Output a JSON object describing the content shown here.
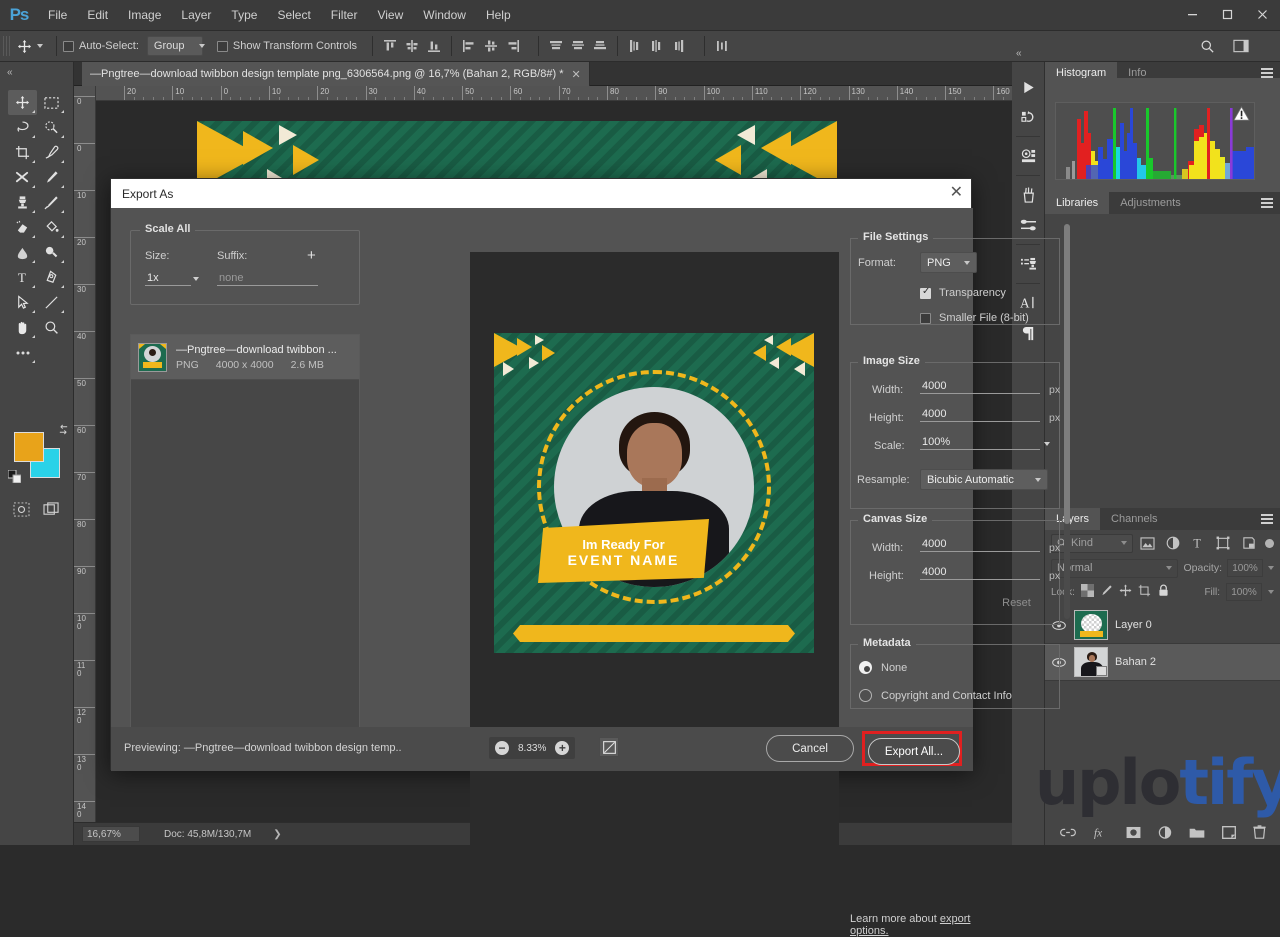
{
  "app": {
    "logo": "Ps",
    "menus": [
      "File",
      "Edit",
      "Image",
      "Layer",
      "Type",
      "Select",
      "Filter",
      "View",
      "Window",
      "Help"
    ],
    "window_controls": {
      "minimize": "–",
      "maximize": "❐",
      "close": "✕"
    }
  },
  "options_bar": {
    "auto_select_label": "Auto-Select:",
    "auto_select_checked": false,
    "group_value": "Group",
    "show_transform_label": "Show Transform Controls",
    "show_transform_checked": false
  },
  "document_tab": {
    "title": "—Pngtree—download twibbon design template png_6306564.png @ 16,7% (Bahan 2, RGB/8#) *",
    "close": "✕"
  },
  "rulers": {
    "horizontal_labels": [
      "20",
      "10",
      "0",
      "10",
      "20",
      "30",
      "40",
      "50",
      "60",
      "70",
      "80",
      "90",
      "100",
      "110",
      "120",
      "130",
      "140",
      "150",
      "160"
    ],
    "vertical_labels": [
      "0",
      "0",
      "10",
      "20",
      "30",
      "40",
      "50",
      "60",
      "70",
      "80",
      "90",
      "100",
      "110",
      "120",
      "130",
      "140"
    ]
  },
  "status_bar": {
    "zoom": "16,67%",
    "doc": "Doc: 45,8M/130,7M",
    "arrow": "❯"
  },
  "panels": {
    "histogram": {
      "tabs": [
        "Histogram",
        "Info"
      ],
      "active": "Histogram",
      "warning_icon": "warning-triangle"
    },
    "libraries": {
      "tabs": [
        "Libraries",
        "Adjustments"
      ],
      "active": "Libraries"
    },
    "layers": {
      "tabs": [
        "Layers",
        "Channels"
      ],
      "active": "Layers",
      "kind_filter": "Kind",
      "blend_mode": "Normal",
      "opacity_label": "Opacity:",
      "opacity_value": "100%",
      "lock_label": "Lock:",
      "fill_label": "Fill:",
      "fill_value": "100%",
      "rows": [
        {
          "name": "Layer 0",
          "visible": true,
          "selected": false
        },
        {
          "name": "Bahan 2",
          "visible": true,
          "selected": true
        }
      ]
    }
  },
  "dialog": {
    "title": "Export As",
    "close": "✕",
    "scale_all": {
      "group_label": "Scale All",
      "size_label": "Size:",
      "size_value": "1x",
      "suffix_label": "Suffix:",
      "suffix_placeholder": "none",
      "add_label": "+"
    },
    "asset": {
      "name": "—Pngtree—download twibbon ...",
      "format": "PNG",
      "dimensions": "4000 x 4000",
      "filesize": "2.6 MB"
    },
    "file_settings": {
      "group_label": "File Settings",
      "format_label": "Format:",
      "format_value": "PNG",
      "transparency_label": "Transparency",
      "transparency_checked": true,
      "smaller_file_label": "Smaller File (8-bit)",
      "smaller_file_checked": false
    },
    "image_size": {
      "group_label": "Image Size",
      "width_label": "Width:",
      "width_value": "4000",
      "height_label": "Height:",
      "height_value": "4000",
      "scale_label": "Scale:",
      "scale_value": "100%",
      "resample_label": "Resample:",
      "resample_value": "Bicubic Automatic",
      "unit": "px"
    },
    "canvas_size": {
      "group_label": "Canvas Size",
      "width_label": "Width:",
      "width_value": "4000",
      "height_label": "Height:",
      "height_value": "4000",
      "reset_label": "Reset",
      "unit": "px"
    },
    "metadata": {
      "group_label": "Metadata",
      "none_label": "None",
      "none_selected": true,
      "copyright_label": "Copyright and Contact Info",
      "copyright_selected": false
    },
    "learn_more": {
      "prefix": "Learn more about ",
      "link": "export options."
    },
    "footer": {
      "previewing": "Previewing: —Pngtree—download twibbon design temp..",
      "zoom_out": "−",
      "zoom_value": "8.33%",
      "zoom_in": "+",
      "cancel_label": "Cancel",
      "export_label": "Export All..."
    }
  },
  "poster": {
    "line1": "Im Ready For",
    "line2": "EVENT NAME",
    "colors": {
      "green": "#1d6b4f",
      "yellow": "#f0b71c",
      "cream": "#f2ead6"
    }
  },
  "watermark": {
    "dark_text": "uplo",
    "blue_text": "tify"
  }
}
